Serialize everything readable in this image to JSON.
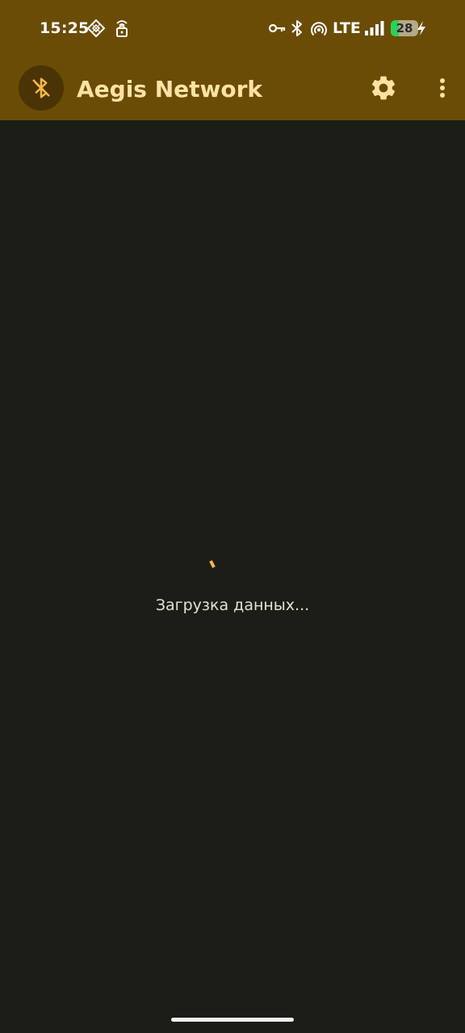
{
  "status_bar": {
    "time": "15:25",
    "network_type": "LTE",
    "battery_level": "28",
    "battery_fraction": 0.28,
    "left_icons": [
      "nfc-pay-icon",
      "vpn-lock-icon"
    ],
    "right_icons": [
      "key-icon",
      "bluetooth-icon",
      "hotspot-icon",
      "signal-icon",
      "battery-icon",
      "charging-icon"
    ]
  },
  "app_bar": {
    "title": "Aegis Network",
    "logo_icon": "bluetooth-disabled-icon",
    "actions": [
      "settings-icon",
      "more-vert-icon"
    ]
  },
  "content": {
    "loading_text": "Загрузка данных..."
  },
  "colors": {
    "app_bar_bg": "#6b4c06",
    "background": "#1b1d16",
    "title": "#fde2a4",
    "accent": "#f5b74a",
    "battery_green": "#2ed158"
  }
}
